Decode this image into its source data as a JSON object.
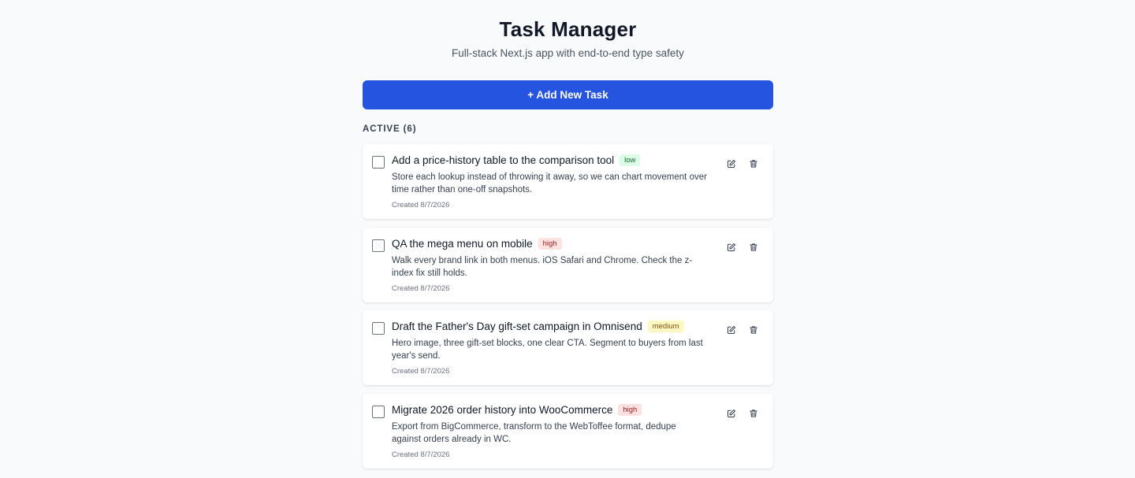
{
  "header": {
    "title": "Task Manager",
    "subtitle": "Full-stack Next.js app with end-to-end type safety"
  },
  "add_button_label": "+ Add New Task",
  "section_label": "ACTIVE (6)",
  "tasks": [
    {
      "title": "Add a price-history table to the comparison tool",
      "priority": "low",
      "description": "Store each lookup instead of throwing it away, so we can chart movement over time rather than one-off snapshots.",
      "created": "Created 8/7/2026"
    },
    {
      "title": "QA the mega menu on mobile",
      "priority": "high",
      "description": "Walk every brand link in both menus. iOS Safari and Chrome. Check the z-index fix still holds.",
      "created": "Created 8/7/2026"
    },
    {
      "title": "Draft the Father's Day gift-set campaign in Omnisend",
      "priority": "medium",
      "description": "Hero image, three gift-set blocks, one clear CTA. Segment to buyers from last year's send.",
      "created": "Created 8/7/2026"
    },
    {
      "title": "Migrate 2026 order history into WooCommerce",
      "priority": "high",
      "description": "Export from BigCommerce, transform to the WebToffee format, dedupe against orders already in WC.",
      "created": "Created 8/7/2026"
    }
  ],
  "colors": {
    "accent": "#2454e0",
    "low": "#dcfce7",
    "high": "#fee2e2",
    "medium": "#fef9c3"
  },
  "icons": {
    "edit": "edit-icon",
    "delete": "trash-icon"
  }
}
